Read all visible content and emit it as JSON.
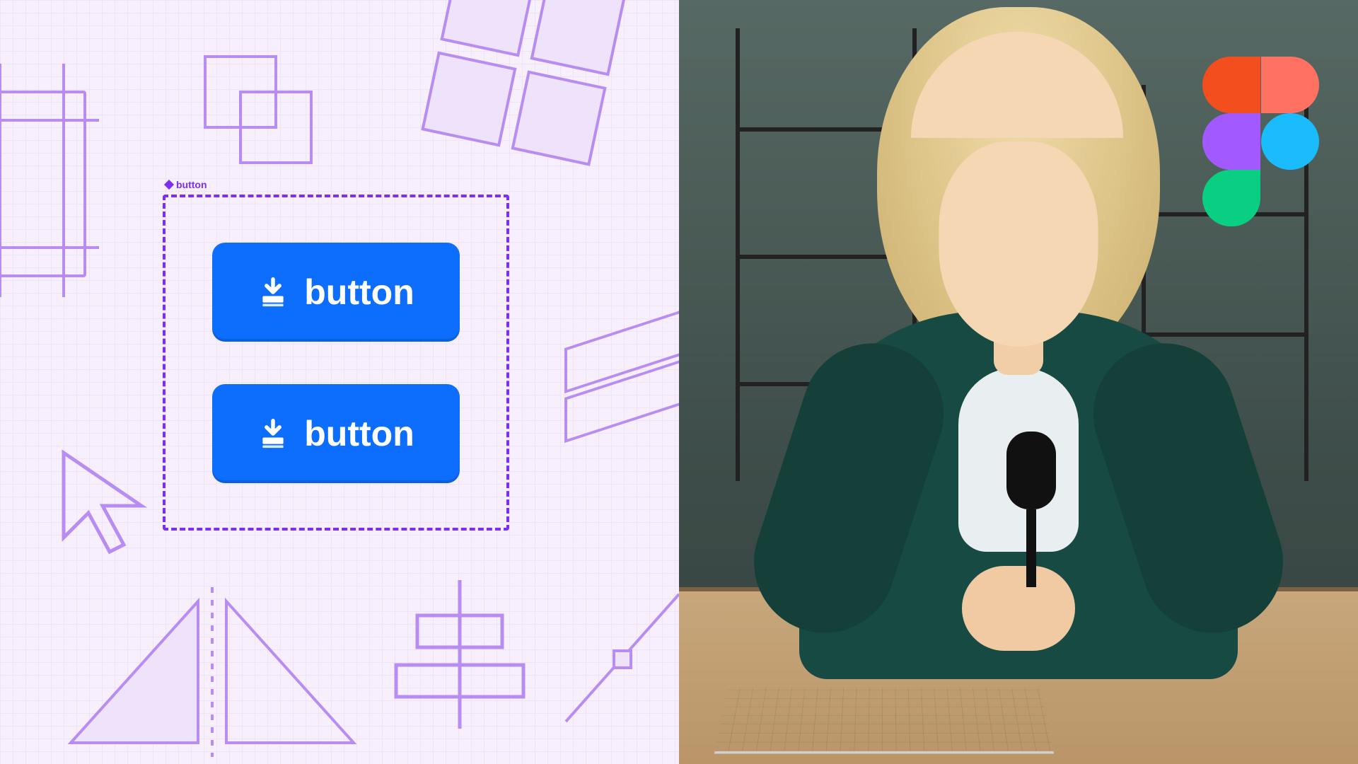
{
  "canvas": {
    "component_label": "button",
    "buttons": [
      {
        "label": "button"
      },
      {
        "label": "button"
      }
    ]
  },
  "colors": {
    "accent_purple": "#7b2ff2",
    "button_blue": "#0d6efd",
    "grid_bg": "#f7f0fc"
  },
  "brand": {
    "logo": "figma"
  }
}
